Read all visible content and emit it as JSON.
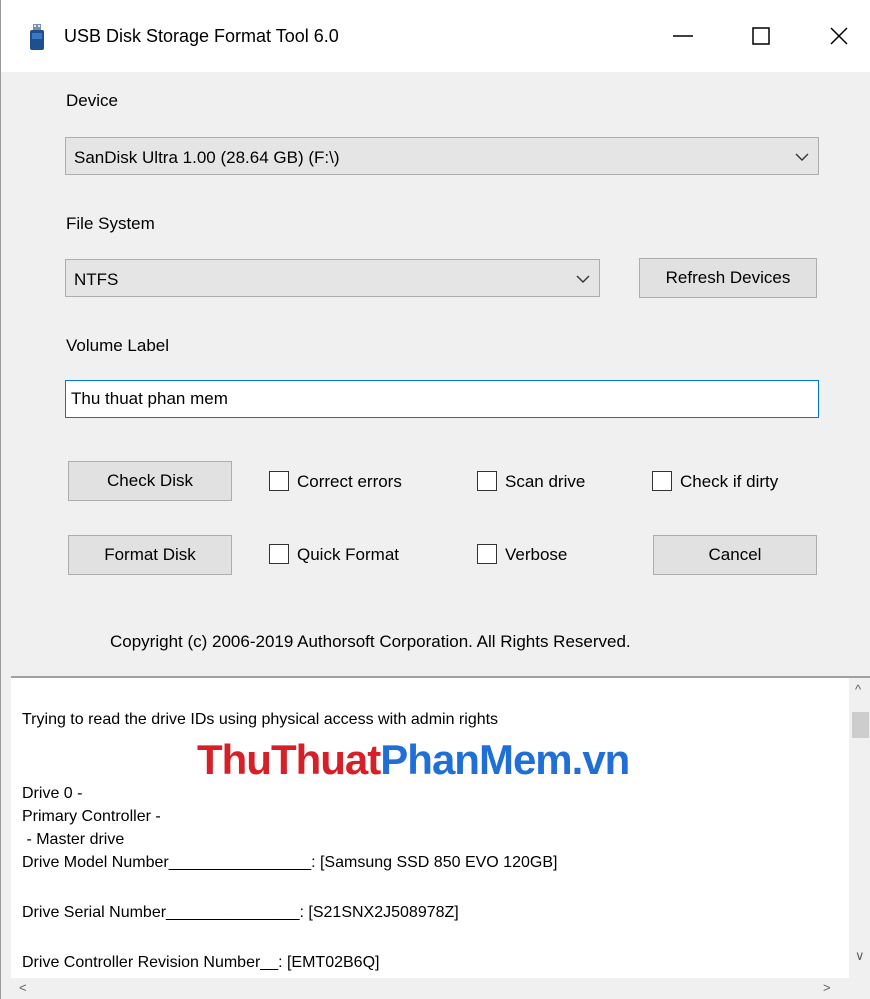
{
  "window": {
    "title": "USB Disk Storage Format Tool 6.0"
  },
  "device": {
    "label": "Device",
    "selected": "SanDisk  Ultra  1.00 (28.64 GB) (F:\\)"
  },
  "file_system": {
    "label": "File System",
    "selected": "NTFS"
  },
  "refresh_label": "Refresh Devices",
  "volume": {
    "label": "Volume Label",
    "value": "Thu thuat phan mem"
  },
  "check_disk_label": "Check Disk",
  "format_disk_label": "Format Disk",
  "cancel_label": "Cancel",
  "options": {
    "correct_errors": "Correct errors",
    "scan_drive": "Scan drive",
    "check_if_dirty": "Check if dirty",
    "quick_format": "Quick Format",
    "verbose": "Verbose"
  },
  "copyright": "Copyright (c) 2006-2019 Authorsoft Corporation. All Rights Reserved.",
  "watermark": {
    "part1": "ThuThuat",
    "part2": "PhanMem.vn"
  },
  "log_lines": [
    "Trying to read the drive IDs using physical access with admin rights",
    "Drive 0 -",
    "Primary Controller -",
    " - Master drive",
    "Drive Model Number________________: [Samsung SSD 850 EVO 120GB]",
    "Drive Serial Number_______________: [S21SNX2J508978Z]",
    "Drive Controller Revision Number__: [EMT02B6Q]"
  ],
  "icons": {
    "app": "usb-drive-icon",
    "minimize": "minimize-icon",
    "maximize": "maximize-icon",
    "close": "close-icon"
  }
}
